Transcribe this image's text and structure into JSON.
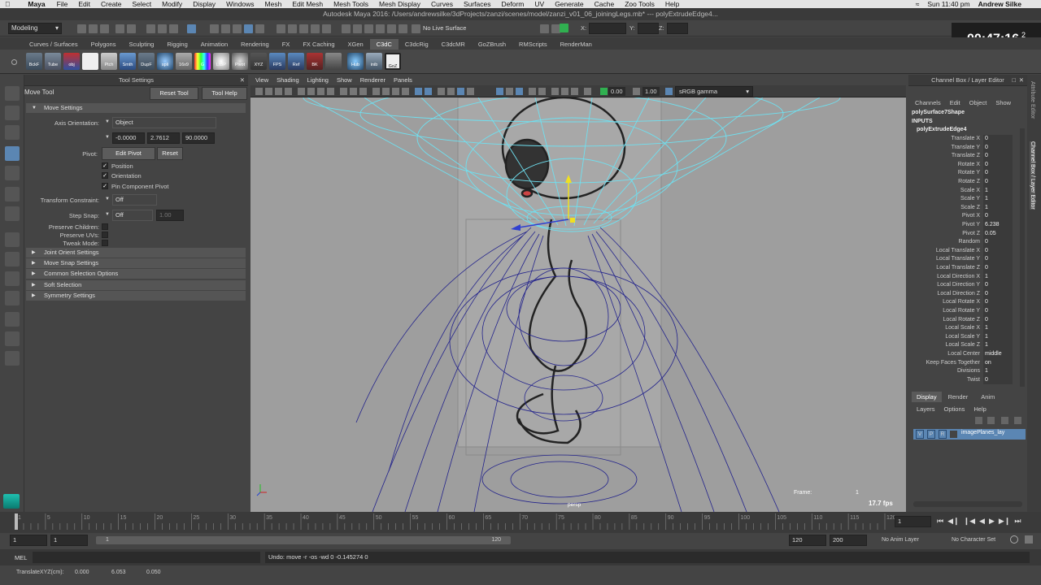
{
  "mac_menu": {
    "app": "Maya",
    "items": [
      "File",
      "Edit",
      "Create",
      "Select",
      "Modify",
      "Display",
      "Windows",
      "Mesh",
      "Edit Mesh",
      "Mesh Tools",
      "Mesh Display",
      "Curves",
      "Surfaces",
      "Deform",
      "UV",
      "Generate",
      "Cache",
      "Zoo Tools",
      "Help"
    ],
    "clock": "Sun 11:40 pm",
    "user": "Andrew Silke"
  },
  "window_title": "Autodesk Maya 2016: /Users/andrewsilke/3dProjects/zanzi/scenes/model/zanzi_v01_06_joiningLegs.mb*  ---  polyExtrudeEdge4...",
  "status_line": {
    "menu_set": "Modeling",
    "live_surface": "No Live Surface",
    "x_label": "X:",
    "y_label": "Y:",
    "z_label": "Z:"
  },
  "timer": {
    "time": "00:47:16",
    "index": "2"
  },
  "shelf_tabs": [
    "Curves / Surfaces",
    "Polygons",
    "Sculpting",
    "Rigging",
    "Animation",
    "Rendering",
    "FX",
    "FX Caching",
    "XGen",
    "C3dC",
    "C3dcRig",
    "C3dcMR",
    "GoZBrush",
    "RMScripts",
    "RenderMan"
  ],
  "shelf_active_tab": "C3dC",
  "shelf_icons": [
    "BckF",
    "Tube",
    "obj",
    "",
    "Ptch",
    "Smth",
    "DupF",
    "spli",
    "16x9",
    "G",
    "LtBP",
    "Pivot",
    "XYZ",
    "FPS",
    "Ref",
    "BK",
    "",
    "Hub",
    "inib",
    "GoZ"
  ],
  "tool_settings": {
    "panel_title": "Tool Settings",
    "tool_name": "Move Tool",
    "reset_tool": "Reset Tool",
    "tool_help": "Tool Help",
    "move_settings": "Move Settings",
    "axis_orientation_label": "Axis Orientation:",
    "axis_orientation_value": "Object",
    "coord_x": "-0.0000",
    "coord_y": "2.7612",
    "coord_z": "90.0000",
    "pivot_label": "Pivot:",
    "edit_pivot": "Edit Pivot",
    "reset": "Reset",
    "position": "Position",
    "orientation": "Orientation",
    "pin_component_pivot": "Pin Component Pivot",
    "transform_constraint_label": "Transform Constraint:",
    "transform_constraint_value": "Off",
    "step_snap_label": "Step Snap:",
    "step_snap_value": "Off",
    "step_snap_amount": "1.00",
    "preserve_children": "Preserve Children:",
    "preserve_uvs": "Preserve UVs:",
    "tweak_mode": "Tweak Mode:",
    "sections": [
      "Joint Orient Settings",
      "Move Snap Settings",
      "Common Selection Options",
      "Soft Selection",
      "Symmetry Settings"
    ]
  },
  "viewport": {
    "menu": [
      "View",
      "Shading",
      "Lighting",
      "Show",
      "Renderer",
      "Panels"
    ],
    "exposure": "0.00",
    "gamma": "1.00",
    "color_space": "sRGB gamma",
    "frame_label": "Frame:",
    "frame_value": "1",
    "fps": "17.7 fps",
    "camera": "persp"
  },
  "channel_box": {
    "title": "Channel Box / Layer Editor",
    "menu": [
      "Channels",
      "Edit",
      "Object",
      "Show"
    ],
    "shape_name": "polySurface7Shape",
    "inputs_label": "INPUTS",
    "node_name": "polyExtrudeEdge4",
    "channels": [
      {
        "label": "Translate X",
        "value": "0"
      },
      {
        "label": "Translate Y",
        "value": "0"
      },
      {
        "label": "Translate Z",
        "value": "0"
      },
      {
        "label": "Rotate X",
        "value": "0"
      },
      {
        "label": "Rotate Y",
        "value": "0"
      },
      {
        "label": "Rotate Z",
        "value": "0"
      },
      {
        "label": "Scale X",
        "value": "1"
      },
      {
        "label": "Scale Y",
        "value": "1"
      },
      {
        "label": "Scale Z",
        "value": "1"
      },
      {
        "label": "Pivot X",
        "value": "0"
      },
      {
        "label": "Pivot Y",
        "value": "6.238"
      },
      {
        "label": "Pivot Z",
        "value": "0.05"
      },
      {
        "label": "Random",
        "value": "0"
      },
      {
        "label": "Local Translate X",
        "value": "0"
      },
      {
        "label": "Local Translate Y",
        "value": "0"
      },
      {
        "label": "Local Translate Z",
        "value": "0"
      },
      {
        "label": "Local Direction X",
        "value": "1"
      },
      {
        "label": "Local Direction Y",
        "value": "0"
      },
      {
        "label": "Local Direction Z",
        "value": "0"
      },
      {
        "label": "Local Rotate X",
        "value": "0"
      },
      {
        "label": "Local Rotate Y",
        "value": "0"
      },
      {
        "label": "Local Rotate Z",
        "value": "0"
      },
      {
        "label": "Local Scale X",
        "value": "1"
      },
      {
        "label": "Local Scale Y",
        "value": "1"
      },
      {
        "label": "Local Scale Z",
        "value": "1"
      },
      {
        "label": "Local Center",
        "value": "middle"
      },
      {
        "label": "Keep Faces Together",
        "value": "on"
      },
      {
        "label": "Divisions",
        "value": "1"
      },
      {
        "label": "Twist",
        "value": "0"
      }
    ]
  },
  "layer_editor": {
    "tabs": [
      "Display",
      "Render",
      "Anim"
    ],
    "menu": [
      "Layers",
      "Options",
      "Help"
    ],
    "layer_v": "V",
    "layer_p": "P",
    "layer_r": "R",
    "layer_name": "imagePlanes_lay"
  },
  "side_tabs": [
    "Attribute Editor",
    "Channel Box / Layer Editor"
  ],
  "timeline": {
    "ticks": [
      "1",
      "5",
      "10",
      "15",
      "20",
      "25",
      "30",
      "35",
      "40",
      "45",
      "50",
      "55",
      "60",
      "65",
      "70",
      "75",
      "80",
      "85",
      "90",
      "95",
      "100",
      "105",
      "110",
      "115",
      "120"
    ],
    "current_frame": "1"
  },
  "range": {
    "start": "1",
    "playback_start": "1",
    "slider_start": "1",
    "slider_end": "120",
    "playback_end": "120",
    "end": "200",
    "anim_layer": "No Anim Layer",
    "character_set": "No Character Set"
  },
  "command": {
    "mode": "MEL",
    "output": "Undo: move -r -os -wd 0 -0.145274 0"
  },
  "help_line": {
    "label": "TranslateXYZ(cm):",
    "x": "0.000",
    "y": "6.053",
    "z": "0.050"
  },
  "colors": {
    "selection_blue": "#5b86b3",
    "wire_dark": "#23238c",
    "wire_cyan": "#6fe0f0",
    "viewport_bg": "#9e9e9e"
  }
}
